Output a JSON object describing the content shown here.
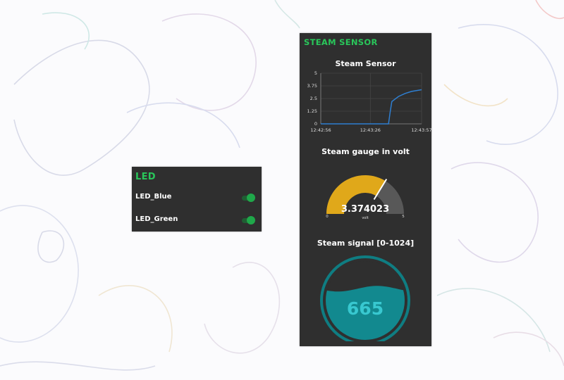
{
  "led_panel": {
    "title": "LED",
    "items": [
      {
        "label": "LED_Blue",
        "state": "on"
      },
      {
        "label": "LED_Green",
        "state": "on"
      }
    ]
  },
  "steam_panel": {
    "title": "STEAM SENSOR",
    "chart": {
      "title": "Steam Sensor",
      "chart_data": {
        "type": "line",
        "title": "Steam Sensor",
        "xlabel": "",
        "ylabel": "",
        "ylim": [
          0,
          5
        ],
        "y_ticks": [
          "5",
          "3.75",
          "2.5",
          "1.25",
          "0"
        ],
        "x_ticks": [
          "12:42:56",
          "12:43:26",
          "12:43:57"
        ],
        "grid": true,
        "series": [
          {
            "color": "#2f7fd1",
            "points": [
              {
                "x": "12:42:56",
                "y": 0
              },
              {
                "x": "12:43:37",
                "y": 0
              },
              {
                "x": "12:43:38",
                "y": 1.2
              },
              {
                "x": "12:43:39",
                "y": 2.2
              },
              {
                "x": "12:43:43",
                "y": 2.7
              },
              {
                "x": "12:43:47",
                "y": 3.0
              },
              {
                "x": "12:43:51",
                "y": 3.2
              },
              {
                "x": "12:43:57",
                "y": 3.37
              }
            ]
          }
        ]
      }
    },
    "gauge": {
      "title": "Steam gauge in volt",
      "value": "3.374023",
      "numeric_value": 3.374023,
      "min": "0",
      "max": "5",
      "unit": "volt",
      "fill_color": "#e0a81a",
      "track_color": "#585858"
    },
    "level": {
      "title": "Steam signal [0-1024]",
      "value": "665",
      "numeric_value": 665,
      "max": 1024,
      "color": "#12898f",
      "text_color": "#38c8d0"
    }
  }
}
